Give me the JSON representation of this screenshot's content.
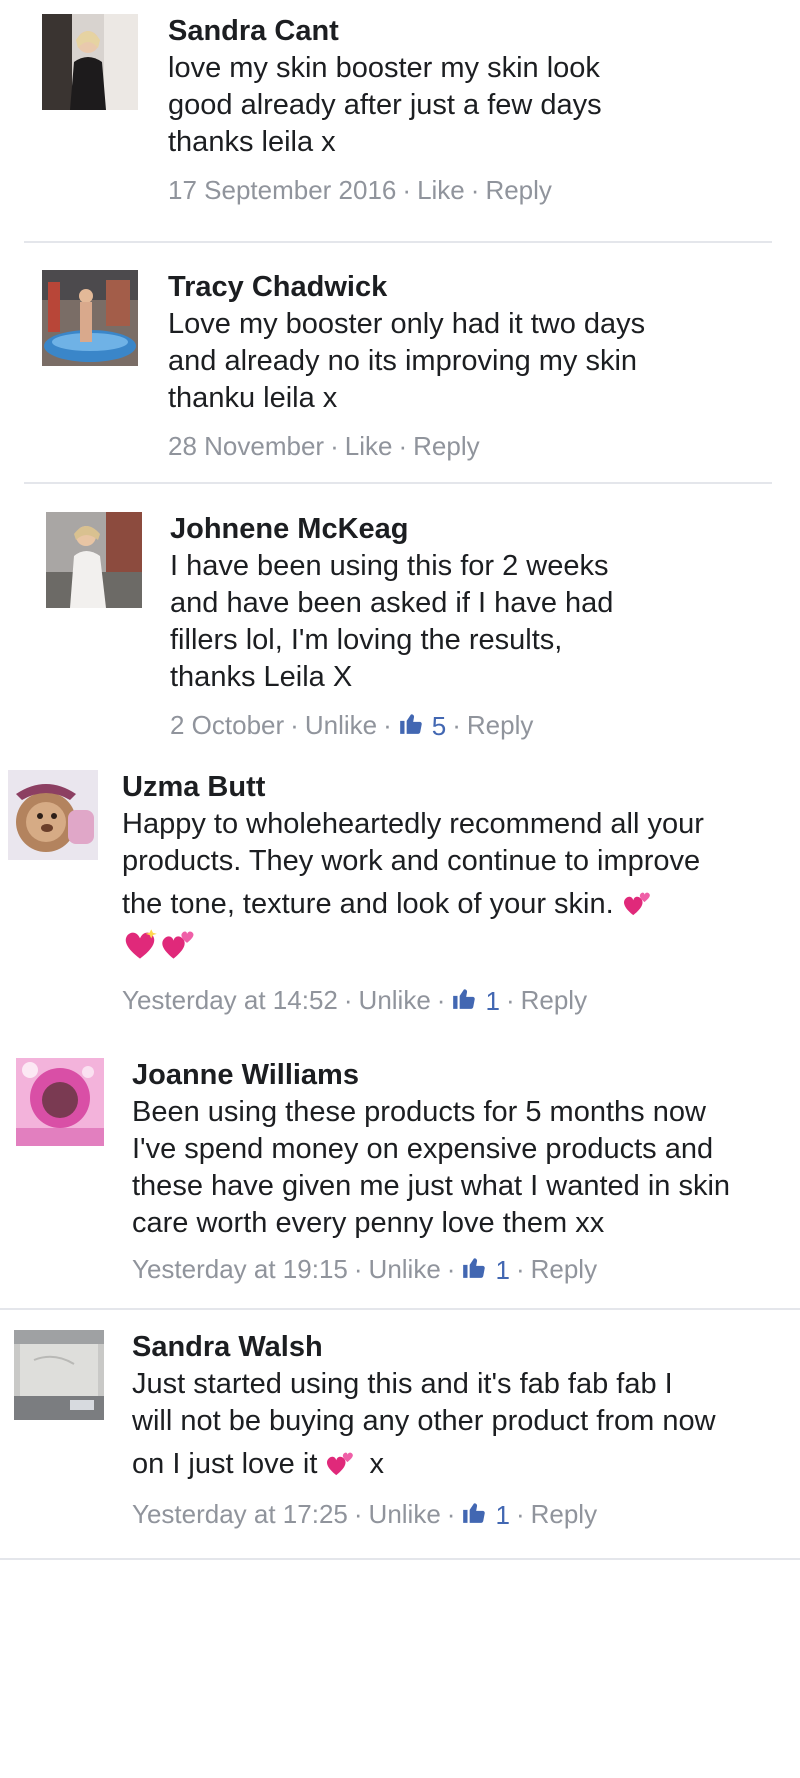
{
  "comments": [
    {
      "name": "Sandra Cant",
      "lines": [
        "love my skin booster my skin look",
        "good already after just a few days",
        "thanks leila x"
      ],
      "date": "17 September 2016",
      "like_label": "Like",
      "reply_label": "Reply",
      "like_count": ""
    },
    {
      "name": "Tracy Chadwick",
      "lines": [
        "Love my booster only had it two days",
        "and already no its improving my skin",
        "thanku leila x"
      ],
      "date": "28 November",
      "like_label": "Like",
      "reply_label": "Reply",
      "like_count": ""
    },
    {
      "name": "Johnene McKeag",
      "lines": [
        "I have been using this for 2 weeks",
        "and have been asked if I have had",
        "fillers lol, I'm loving the results,",
        "thanks Leila X"
      ],
      "date": "2 October",
      "like_label": "Unlike",
      "reply_label": "Reply",
      "like_count": "5"
    },
    {
      "name": "Uzma Butt",
      "lines": [
        "Happy to wholeheartedly recommend all your",
        "products. They work and continue to improve",
        "the tone, texture and look of your skin."
      ],
      "date": "Yesterday at 14:52",
      "like_label": "Unlike",
      "reply_label": "Reply",
      "like_count": "1"
    },
    {
      "name": "Joanne Williams",
      "lines": [
        "Been using these products for 5 months now",
        "I've spend money on expensive products and",
        "these have given me just what I wanted in skin",
        "care worth every penny love them xx"
      ],
      "date": "Yesterday at 19:15",
      "like_label": "Unlike",
      "reply_label": "Reply",
      "like_count": "1"
    },
    {
      "name": "Sandra Walsh",
      "lines": [
        "Just started using this and it's fab fab fab I",
        "will not be buying any other product from now",
        "on I just love it"
      ],
      "tail": "x",
      "date": "Yesterday at 17:25",
      "like_label": "Unlike",
      "reply_label": "Reply",
      "like_count": "1"
    }
  ],
  "colors": {
    "text": "#1c1e21",
    "meta": "#90949c",
    "like_blue": "#4267b2",
    "heart_pink": "#e0297a",
    "divider": "#e4e6eb"
  },
  "icons": {
    "like": "thumbs-up-icon",
    "emoji": "two-hearts-icon",
    "emoji_sparkle": "sparkling-heart-icon"
  }
}
